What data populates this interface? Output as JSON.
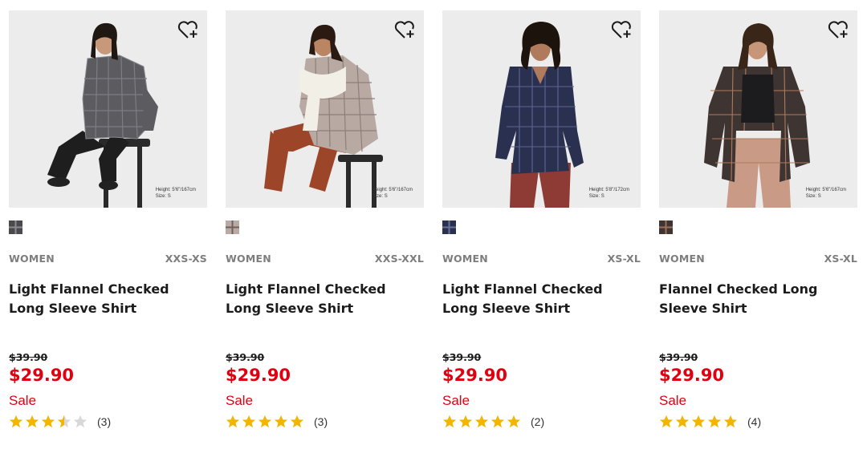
{
  "colors": {
    "sale_red": "#e1000f",
    "star": "#f2b600",
    "star_empty": "#d8d8d8",
    "category": "#7d7d7d"
  },
  "products": [
    {
      "category": "WOMEN",
      "sizes": "XXS-XS",
      "name": "Light Flannel Checked Long Sleeve Shirt",
      "original_price": "$39.90",
      "price": "$29.90",
      "badge": "Sale",
      "rating": 3.5,
      "review_count": "(3)",
      "photo_note": [
        "Height: 5'6\"/167cm",
        "Size: S"
      ],
      "favorite_icon": "heart-plus-icon",
      "swatch_color": "#4a4a4e"
    },
    {
      "category": "WOMEN",
      "sizes": "XXS-XXL",
      "name": "Light Flannel Checked Long Sleeve Shirt",
      "original_price": "$39.90",
      "price": "$29.90",
      "badge": "Sale",
      "rating": 5,
      "review_count": "(3)",
      "photo_note": [
        "Height: 5'6\"/167cm",
        "Size: S"
      ],
      "favorite_icon": "heart-plus-icon",
      "swatch_color": "#b9aaa5"
    },
    {
      "category": "WOMEN",
      "sizes": "XS-XL",
      "name": "Light Flannel Checked Long Sleeve Shirt",
      "original_price": "$39.90",
      "price": "$29.90",
      "badge": "Sale",
      "rating": 5,
      "review_count": "(2)",
      "photo_note": [
        "Height: 5'8\"/172cm",
        "Size: S"
      ],
      "favorite_icon": "heart-plus-icon",
      "swatch_color": "#2a3150"
    },
    {
      "category": "WOMEN",
      "sizes": "XS-XL",
      "name": "Flannel Checked Long Sleeve Shirt",
      "original_price": "$39.90",
      "price": "$29.90",
      "badge": "Sale",
      "rating": 5,
      "review_count": "(4)",
      "photo_note": [
        "Height: 5'6\"/167cm",
        "Size: S"
      ],
      "favorite_icon": "heart-plus-icon",
      "swatch_color": "#3e3432"
    }
  ]
}
